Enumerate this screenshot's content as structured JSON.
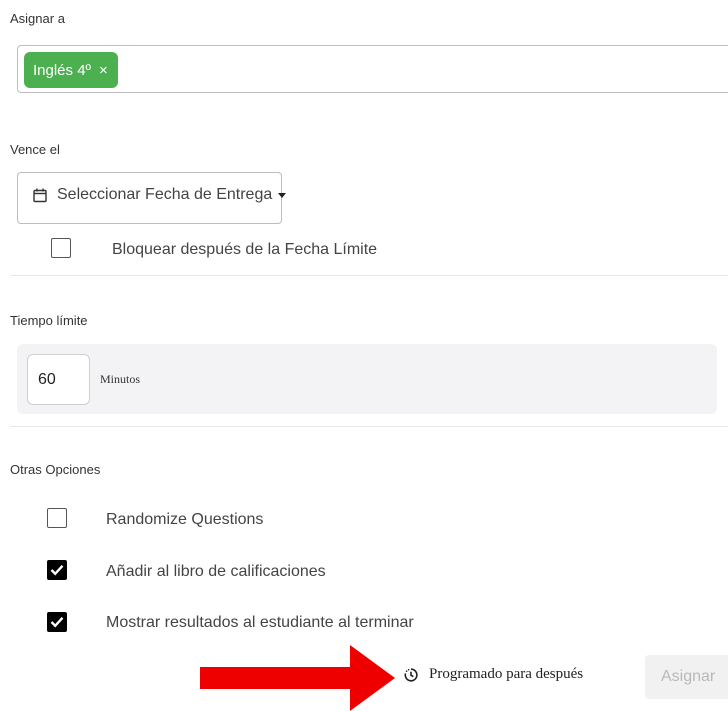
{
  "assign": {
    "label": "Asignar a",
    "chip_label": "Inglés 4º",
    "chip_remove": "×",
    "colors": {
      "chip_bg": "#4caf50"
    }
  },
  "due": {
    "label": "Vence el",
    "date_placeholder": "Seleccionar Fecha de Entrega",
    "lock_label": "Bloquear después de la Fecha Límite",
    "lock_checked": false
  },
  "time_limit": {
    "label": "Tiempo límite",
    "value": "60",
    "unit": "Minutos"
  },
  "other_options": {
    "label": "Otras Opciones",
    "items": [
      {
        "label": "Randomize Questions",
        "checked": false
      },
      {
        "label": "Añadir al libro de calificaciones",
        "checked": true
      },
      {
        "label": "Mostrar resultados al estudiante al terminar",
        "checked": true
      }
    ]
  },
  "footer": {
    "schedule_label": "Programado para después",
    "assign_label": "Asignar",
    "arrow_color": "#ee0000"
  }
}
